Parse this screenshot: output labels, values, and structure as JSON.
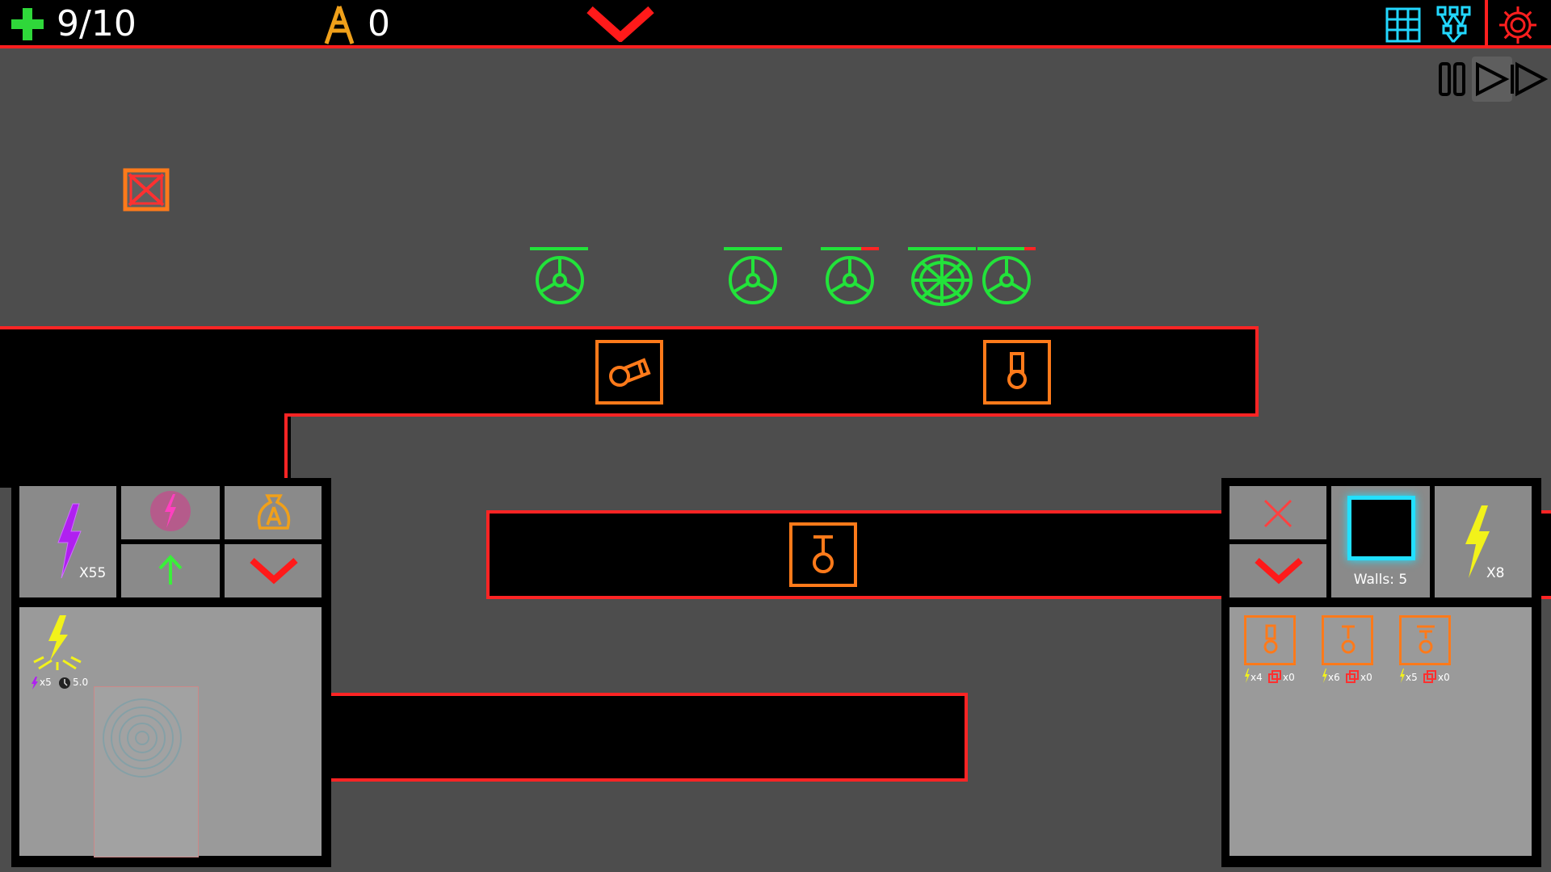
{
  "hud": {
    "lives": "9/10",
    "currency": "0"
  },
  "colors": {
    "wall_border": "#ff2424",
    "turret": "#ff7a1a",
    "enemy": "#22e33a",
    "energy_yellow": "#f2f21a",
    "energy_purple": "#b020f0",
    "wall_cyan": "#22e0ff"
  },
  "icons": {
    "lives": "plus-icon",
    "currency": "tower-coin-icon",
    "dropdown": "chevron-down-icon",
    "grid": "grid-icon",
    "network": "network-icon",
    "settings": "gear-icon",
    "pause": "pause-icon",
    "play": "play-icon",
    "fast_forward": "fast-forward-icon"
  },
  "left_panel": {
    "energy_count": "X55",
    "ability_stats": {
      "energy_cost": "x5",
      "cooldown": "5.0"
    }
  },
  "right_panel": {
    "walls_label": "Walls: 5",
    "energy_count": "X8",
    "turrets": [
      {
        "energy": "x4",
        "walls": "x0"
      },
      {
        "energy": "x6",
        "walls": "x0"
      },
      {
        "energy": "x5",
        "walls": "x0"
      }
    ]
  }
}
